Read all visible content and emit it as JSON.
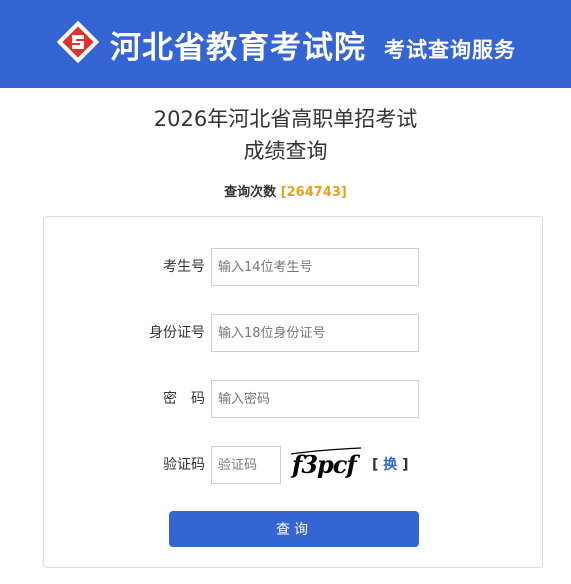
{
  "header": {
    "site_name": "河北省教育考试院",
    "site_subtitle": "考试查询服务",
    "brand_color": "#3565d3"
  },
  "page": {
    "title_line1": "2026年河北省高职单招考试",
    "title_line2": "成绩查询"
  },
  "counter": {
    "label": "查询次数",
    "open": "[",
    "value": "264743",
    "close": "]",
    "value_color": "#e8a21a"
  },
  "form": {
    "exam_no": {
      "label": "考生号",
      "placeholder": "输入14位考生号"
    },
    "id_no": {
      "label": "身份证号",
      "placeholder": "输入18位身份证号"
    },
    "password": {
      "label": "密　码",
      "placeholder": "输入密码"
    },
    "captcha": {
      "label": "验证码",
      "placeholder": "验证码",
      "image_text": "f3pcf",
      "refresh_open": "[",
      "refresh_label": "换",
      "refresh_close": "]"
    },
    "submit_label": "查询"
  },
  "icons": {
    "logo": "hebei-exam-logo-icon"
  }
}
